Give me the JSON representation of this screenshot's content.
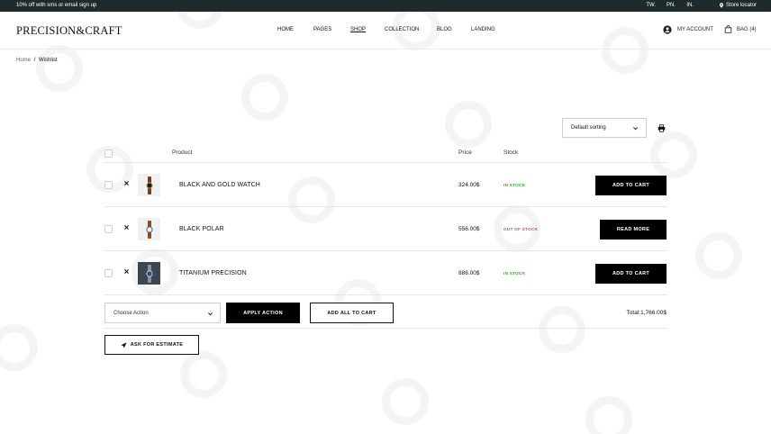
{
  "topbar": {
    "promo": "10% off with sms or email sign up",
    "social": [
      "TW.",
      "PN.",
      "IN."
    ],
    "store_locator": "Store locator"
  },
  "header": {
    "logo": "PRECISION&CRAFT",
    "nav": [
      {
        "label": "HOME",
        "active": false
      },
      {
        "label": "PAGES",
        "active": false
      },
      {
        "label": "SHOP",
        "active": true
      },
      {
        "label": "COLLECTION",
        "active": false
      },
      {
        "label": "BLOG",
        "active": false
      },
      {
        "label": "LANDING",
        "active": false
      }
    ],
    "account_label": "MY ACCOUNT",
    "bag_label": "BAG (4)"
  },
  "breadcrumb": {
    "home": "Home",
    "separator": "/",
    "current": "Wishlist"
  },
  "sorting": {
    "selected": "Default sorting"
  },
  "table": {
    "headers": {
      "product": "Product",
      "price": "Price",
      "stock": "Stock"
    },
    "rows": [
      {
        "name": "BLACK AND GOLD WATCH",
        "price": "324.00$",
        "stock": "IN STOCK",
        "stock_color": "#3a9a3a",
        "action": "ADD TO CART"
      },
      {
        "name": "BLACK POLAR",
        "price": "556.00$",
        "stock": "OUT OF STOCK",
        "stock_color": "#e0434f",
        "action": "READ MORE"
      },
      {
        "name": "TITANIUM PRECISION",
        "price": "886.00$",
        "stock": "IN STOCK",
        "stock_color": "#3a9a3a",
        "action": "ADD TO CART"
      }
    ]
  },
  "actions": {
    "choose_action": "Choose Action",
    "apply_action": "APPLY ACTION",
    "add_all_to_cart": "ADD ALL TO CART",
    "total": "Total:1,766.00$",
    "ask_estimate": "ASK FOR ESTIMATE"
  },
  "colors": {
    "topbar_bg": "#1e2b2d",
    "button_bg": "#000000",
    "in_stock": "#3a9a3a",
    "out_of_stock": "#e0434f"
  }
}
